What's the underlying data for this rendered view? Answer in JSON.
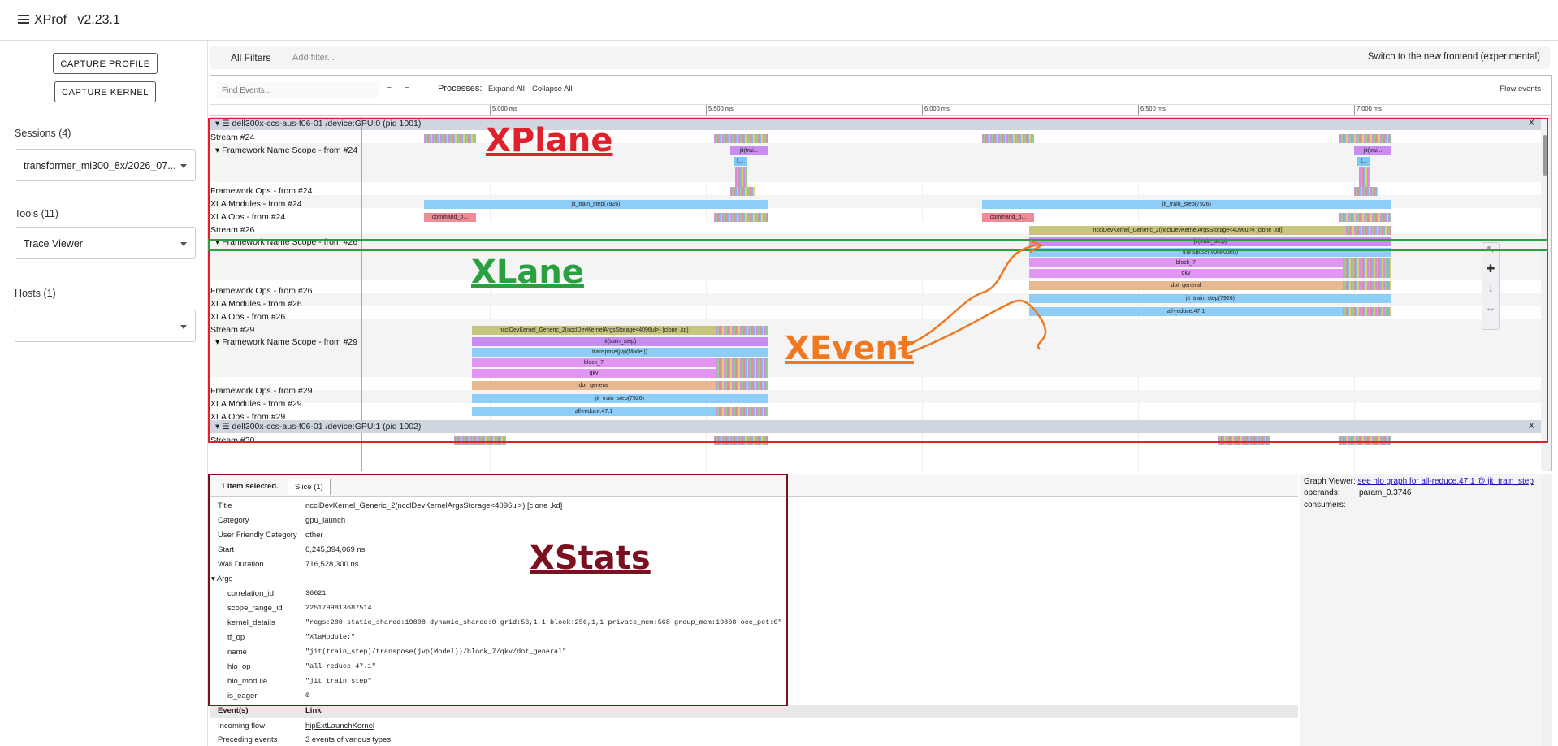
{
  "app": {
    "title": "XProf",
    "version": "v2.23.1"
  },
  "sidebar": {
    "capture_profile": "CAPTURE PROFILE",
    "capture_kernel": "CAPTURE KERNEL",
    "sessions_label": "Sessions (4)",
    "session_value": "transformer_mi300_8x/2026_07...",
    "tools_label": "Tools (11)",
    "tool_value": "Trace Viewer",
    "hosts_label": "Hosts (1)",
    "host_value": ""
  },
  "filterbar": {
    "all_filters": "All Filters",
    "add_filter_placeholder": "Add filter...",
    "switch_frontend": "Switch to the new frontend (experimental)"
  },
  "toolbar": {
    "find_placeholder": "Find Events...",
    "processes_label": "Processes:",
    "expand_all": "Expand All",
    "collapse_all": "Collapse All",
    "flow_events": "Flow events"
  },
  "ruler_ticks": [
    "5,000 ms",
    "5,500 ms",
    "6,000 ms",
    "6,500 ms",
    "7,000 ms"
  ],
  "process1": {
    "header": "dell300x-ccs-aus-f06-01 /device:GPU:0 (pid 1001)",
    "close": "X",
    "rows": [
      "Stream #24",
      "Framework Name Scope - from #24",
      "Framework Ops - from #24",
      "XLA Modules - from #24",
      "XLA Ops - from #24",
      "Stream #26",
      "Framework Name Scope - from #26",
      "Framework Ops - from #26",
      "XLA Modules - from #26",
      "XLA Ops - from #26",
      "Stream #29",
      "Framework Name Scope - from #29",
      "Framework Ops - from #29",
      "XLA Modules - from #29",
      "XLA Ops - from #29"
    ]
  },
  "process2": {
    "header": "dell300x-ccs-aus-f06-01 /device:GPU:1 (pid 1002)",
    "close": "X",
    "rows": [
      "Stream #30"
    ]
  },
  "slices": {
    "jit_trai": "jit(trai...",
    "t": "t...",
    "jit_train_step_a": "jit_train_step(7926)",
    "command_b": "command_b...",
    "nccl": "ncclDevKernel_Generic_2(ncclDevKernelArgsStorage<4096ul>) [clone .kd]",
    "jit_train_step": "jit(train_step)",
    "transpose": "transpose(jvp(Model))",
    "block7": "block_7",
    "qkv": "qkv",
    "dot_general": "dot_general",
    "all_reduce": "all-reduce.47.1"
  },
  "annotations": {
    "xplane": "XPlane",
    "xlane": "XLane",
    "xevent": "XEvent",
    "xstats": "XStats"
  },
  "details": {
    "selected": "1 item selected.",
    "tab": "Slice (1)",
    "fields": [
      {
        "k": "Title",
        "v": "ncclDevKernel_Generic_2(ncclDevKernelArgsStorage<4096ul>) [clone .kd]"
      },
      {
        "k": "Category",
        "v": "gpu_launch"
      },
      {
        "k": "User Friendly Category",
        "v": "other"
      },
      {
        "k": "Start",
        "v": "6,245,394,069 ns"
      },
      {
        "k": "Wall Duration",
        "v": "716,528,300 ns"
      }
    ],
    "args_label": "Args",
    "args": [
      {
        "k": "correlation_id",
        "v": "36621"
      },
      {
        "k": "scope_range_id",
        "v": "2251799813687514"
      },
      {
        "k": "kernel_details",
        "v": "\"regs:280 static_shared:19808 dynamic_shared:0 grid:56,1,1 block:256,1,1 private_mem:568 group_mem:19808 occ_pct:0\""
      },
      {
        "k": "tf_op",
        "v": "\"XlaModule:\""
      },
      {
        "k": "name",
        "v": "\"jit(train_step)/transpose(jvp(Model))/block_7/qkv/dot_general\""
      },
      {
        "k": "hlo_op",
        "v": "\"all-reduce.47.1\""
      },
      {
        "k": "hlo_module",
        "v": "\"jit_train_step\""
      },
      {
        "k": "is_eager",
        "v": "0"
      }
    ],
    "events_header": "Event(s)",
    "link_header": "Link",
    "incoming_flow": "Incoming flow",
    "incoming_link": "hipExtLaunchKernel",
    "preceding": "Preceding events",
    "preceding_val": "3 events of various types"
  },
  "graph": {
    "label": "Graph Viewer:",
    "link": "see hlo graph for all-reduce.47.1 @ jit_train_step",
    "operands_k": "operands:",
    "operands_v": "param_0.3746",
    "consumers_k": "consumers:"
  },
  "colors": {
    "xplane": "#e0202a",
    "xlane": "#2aa040",
    "xevent": "#f07820",
    "xstats": "#7a1020"
  }
}
